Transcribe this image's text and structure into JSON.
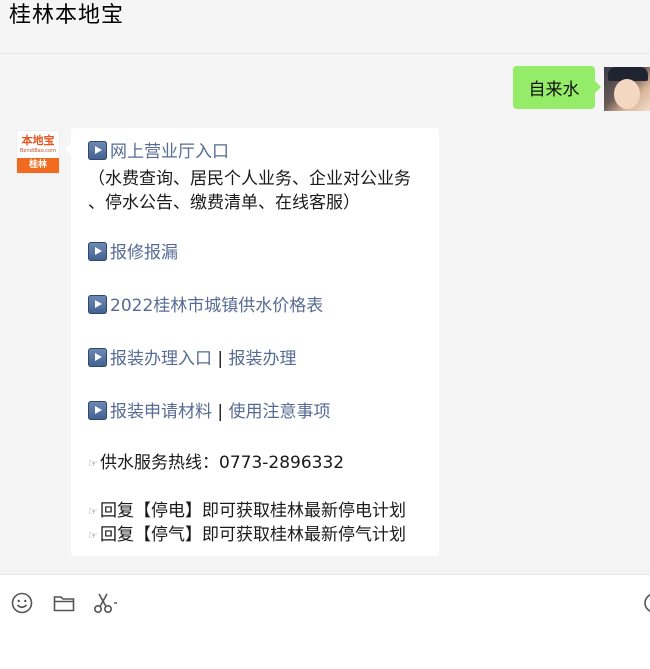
{
  "header": {
    "title": "桂林本地宝"
  },
  "user_message": {
    "text": "自来水",
    "avatar": "user-avatar"
  },
  "bot": {
    "avatar": {
      "logo_text": "本地宝",
      "logo_sub": "BendiBao.com",
      "city": "桂林"
    },
    "lines": {
      "l1_link": "网上营业厅入口",
      "l2": "（水费查询、居民个人业务、企业对公业务",
      "l3": "、停水公告、缴费清单、在线客服）",
      "l4_link": "报修报漏",
      "l5_link": "2022桂林市城镇供水价格表",
      "l6_link_a": "报装办理入口",
      "l6_sep": " | ",
      "l6_link_b": "报装办理",
      "l7_link_a": "报装申请材料",
      "l7_sep": " | ",
      "l7_link_b": "使用注意事项",
      "l8": "供水服务热线：0773-2896332",
      "l9": "回复【停电】即可获取桂林最新停电计划",
      "l10": "回复【停气】即可获取桂林最新停气计划"
    },
    "icons": {
      "play": "play-button-icon",
      "hand": "pointing-hand-icon"
    }
  },
  "toolbar": {
    "icons": [
      "emoji-icon",
      "folder-icon",
      "scissors-icon",
      "more-icon"
    ]
  },
  "colors": {
    "user_bubble": "#95ec69",
    "link": "#576b95",
    "background": "#f5f5f5"
  }
}
